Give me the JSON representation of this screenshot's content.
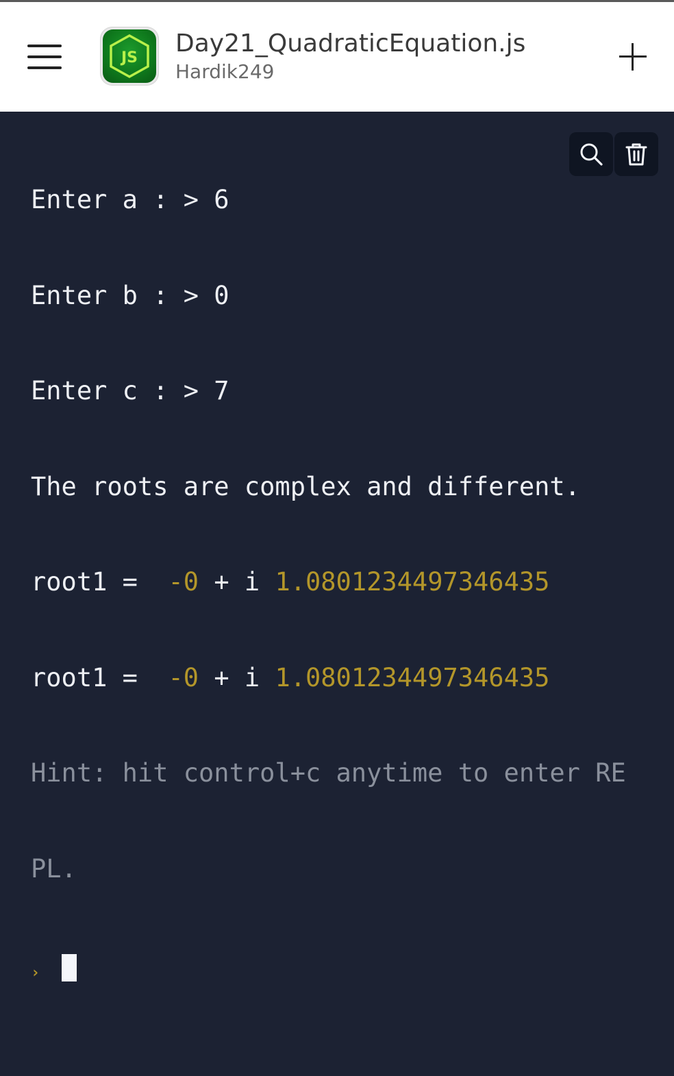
{
  "header": {
    "file_name": "Day21_QuadraticEquation.js",
    "owner": "Hardik249",
    "app_icon": "nodejs-icon",
    "menu_icon": "hamburger-menu-icon",
    "add_icon": "plus-icon"
  },
  "console": {
    "lines": [
      {
        "text": "Enter a : > 6"
      },
      {
        "text": "Enter b : > 0"
      },
      {
        "text": "Enter c : > 7"
      },
      {
        "text": "The roots are complex and different."
      },
      {
        "label": "root1 =  ",
        "real": "-0",
        "mid": " + i ",
        "imag": "1.0801234497346435"
      },
      {
        "label": "root1 =  ",
        "real": "-0",
        "mid": " + i ",
        "imag": "1.0801234497346435"
      }
    ],
    "hint_line1": "Hint: hit control+c anytime to enter RE",
    "hint_line2": "PL.",
    "prompt_symbol": "›"
  },
  "tools": {
    "search_icon": "search-icon",
    "delete_icon": "trash-icon"
  },
  "colors": {
    "background": "#1c2233",
    "accent_yellow": "#b3962a",
    "hint_gray": "#8a909c",
    "header_bg": "#ffffff"
  }
}
